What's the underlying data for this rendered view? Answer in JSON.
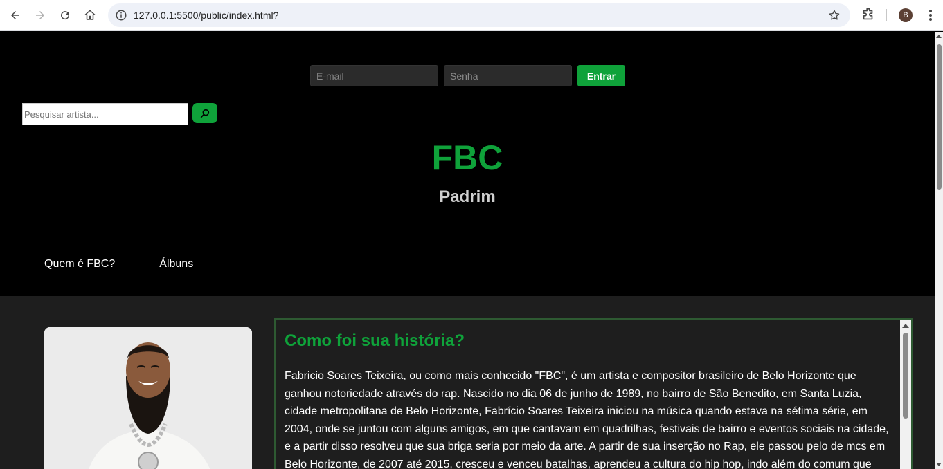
{
  "browser": {
    "url": "127.0.0.1:5500/public/index.html?",
    "profile_initial": "B"
  },
  "login": {
    "email_placeholder": "E-mail",
    "password_placeholder": "Senha",
    "submit_label": "Entrar"
  },
  "search": {
    "placeholder": "Pesquisar artista..."
  },
  "artist": {
    "name": "FBC",
    "subtitle": "Padrim"
  },
  "nav": {
    "items": [
      {
        "label": "Quem é FBC?"
      },
      {
        "label": "Álbuns"
      }
    ]
  },
  "story": {
    "title": "Como foi sua história?",
    "text": "Fabricio Soares Teixeira, ou como mais conhecido \"FBC\", é um artista e compositor brasileiro de Belo Horizonte que ganhou notoriedade através do rap. Nascido no dia 06 de junho de 1989, no bairro de São Benedito, em Santa Luzia, cidade metropolitana de Belo Horizonte, Fabrício Soares Teixeira iniciou na música quando estava na sétima série, em 2004, onde se juntou com alguns amigos, em que cantavam em quadrilhas, festivais de bairro e eventos sociais na cidade, e a partir disso resolveu que sua briga seria por meio da arte. A partir de sua inserção no Rap, ele passou pelo de mcs em Belo Horizonte, de 2007 até 2015, cresceu e venceu batalhas, aprendeu a cultura do hip hop, indo além do comum que"
  },
  "colors": {
    "accent": "#0fa23a",
    "background": "#000000",
    "content_bg": "#1e1e1e",
    "story_border": "#2e5a32"
  }
}
